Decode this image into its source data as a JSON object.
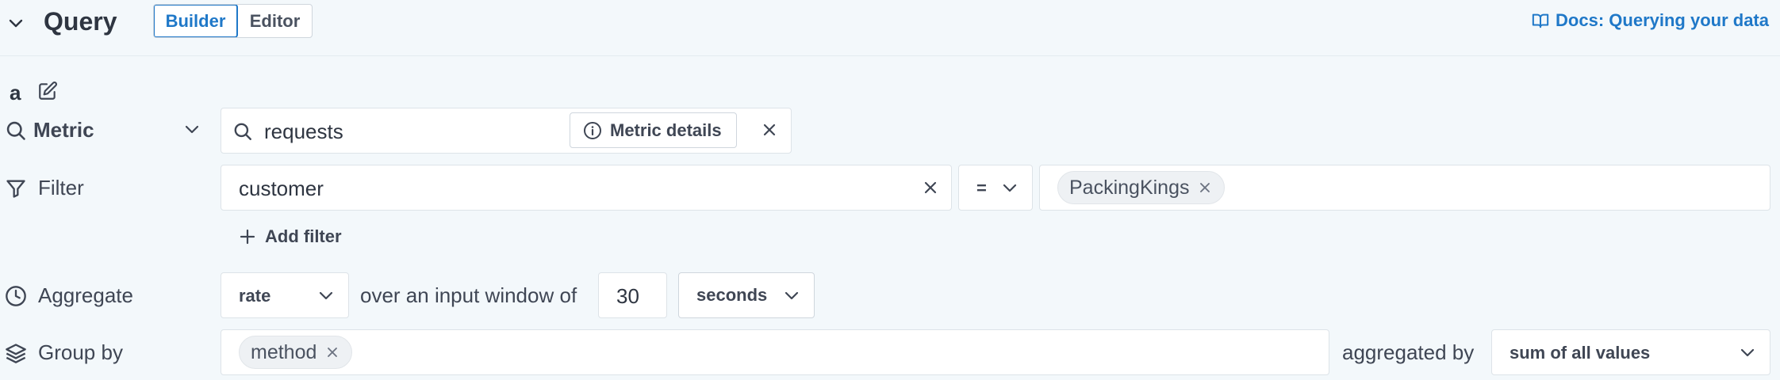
{
  "header": {
    "title": "Query",
    "modes": [
      "Builder",
      "Editor"
    ],
    "active_mode": "Builder",
    "docs_link": "Docs: Querying your data"
  },
  "query": {
    "name": "a",
    "metric": {
      "label": "Metric",
      "value": "requests",
      "details_button": "Metric details"
    },
    "filter": {
      "label": "Filter",
      "key": "customer",
      "operator": "=",
      "values": [
        "PackingKings"
      ],
      "add_label": "Add filter"
    },
    "aggregate": {
      "label": "Aggregate",
      "function": "rate",
      "window_text": "over an input window of",
      "window_value": "30",
      "window_unit": "seconds"
    },
    "group_by": {
      "label": "Group by",
      "tags": [
        "method"
      ],
      "aggregated_by_text": "aggregated by",
      "aggregation": "sum of all values"
    }
  },
  "colors": {
    "background": "#f3f8fb",
    "accent": "#1f78c8",
    "text": "#2e3541"
  }
}
